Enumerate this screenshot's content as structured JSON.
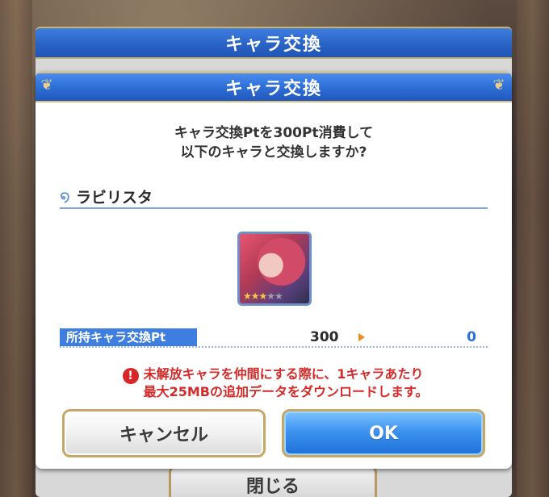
{
  "back_dialog": {
    "title": "キャラ交換",
    "close_label": "閉じる"
  },
  "dialog": {
    "title": "キャラ交換",
    "message_line1": "キャラ交換Ptを300Pt消費して",
    "message_line2": "以下のキャラと交換しますか?",
    "character_name": "ラビリスタ",
    "character_stars": 3,
    "points": {
      "label": "所持キャラ交換Pt",
      "current": "300",
      "after": "0"
    },
    "warning_line1": "未解放キャラを仲間にする際に、1キャラあたり",
    "warning_line2": "最大25MBの追加データをダウンロードします。",
    "cancel_label": "キャンセル",
    "ok_label": "OK"
  },
  "colors": {
    "title_bar": "#2e6fd6",
    "accent_gold": "#c7a765",
    "warning": "#d42a2a",
    "after_value": "#2d6fd8"
  }
}
